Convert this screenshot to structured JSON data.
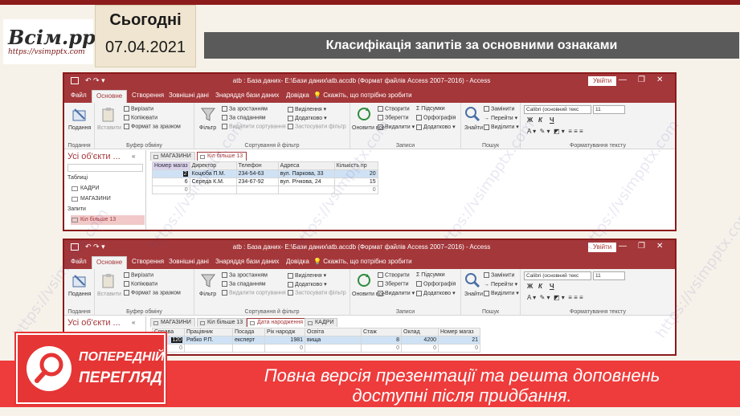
{
  "slide": {
    "logo": "Всім.pptx",
    "logo_url": "https://vsimpptx.com",
    "date_label": "Сьогодні",
    "date": "07.04.2021",
    "title": "Класифікація запитів за основними ознаками",
    "watermark": "https://vsimpptx.com"
  },
  "window1": {
    "title": "atb : База даних- E:\\Бази даних\\atb.accdb (Формат файлів Access 2007–2016)  -  Access",
    "signin": "Увійти",
    "tabs": [
      "Файл",
      "Основне",
      "Створення",
      "Зовнішні дані",
      "Знаряддя бази даних",
      "Довідка"
    ],
    "tellme": "Скажіть, що потрібно зробити",
    "ribbon": {
      "view": "Подання",
      "paste": "Вставити",
      "cut": "Вирізати",
      "copy": "Копіювати",
      "format_painter": "Формат за зразком",
      "filter": "Фільтр",
      "asc": "За зростанням",
      "desc": "За спаданням",
      "remove_sort": "Видалити сортування",
      "selection": "Виділення",
      "advanced": "Додатково",
      "toggle_filter": "Застосувати фільтр",
      "refresh": "Оновити все",
      "new": "Створити",
      "save": "Зберегти",
      "delete": "Видалити",
      "totals": "Підсумки",
      "spelling": "Орфографія",
      "more": "Додатково",
      "find": "Знайти",
      "replace": "Замінити",
      "goto": "Перейти",
      "select": "Виділити",
      "font": "Calibri (основний текс",
      "size": "11",
      "bold": "Ж",
      "italic": "К",
      "underline": "Ч",
      "groups": [
        "Подання",
        "Буфер обміну",
        "Сортування й фільтр",
        "Записи",
        "Пошук",
        "Форматування тексту"
      ]
    },
    "nav": {
      "header": "Усі об'єкти ...",
      "sections": [
        "Таблиці",
        "Запити"
      ],
      "tables": [
        "КАДРИ",
        "МАГАЗИНИ"
      ],
      "queries": [
        "Кіл більше 13"
      ]
    },
    "doc_tabs": [
      "МАГАЗИНИ",
      "Кіл більше 13"
    ],
    "grid": {
      "headers": [
        "Номер магаз",
        "Директор",
        "Телефон",
        "Адреса",
        "Кількість пр"
      ],
      "rows": [
        [
          "2",
          "Коцюба П.М.",
          "234-54-63",
          "вул. Паркова, 33",
          "20"
        ],
        [
          "6",
          "Середа К.М.",
          "234-67-92",
          "вул. Річкова, 24",
          "15"
        ],
        [
          "0",
          "",
          "",
          "",
          "0"
        ]
      ]
    }
  },
  "window2": {
    "title": "atb : База даних- E:\\Бази даних\\atb.accdb (Формат файлів Access 2007–2016)  -  Access",
    "signin": "Увійти",
    "tabs": [
      "Файл",
      "Основне",
      "Створення",
      "Зовнішні дані",
      "Знаряддя бази даних",
      "Довідка"
    ],
    "tellme": "Скажіть, що потрібно зробити",
    "nav_header": "Усі об'єкти ...",
    "doc_tabs": [
      "МАГАЗИНИ",
      "Кіл більше 13",
      "Дата народження",
      "КАДРИ"
    ],
    "grid": {
      "headers": [
        "Справа",
        "Працівник",
        "Посада",
        "Рік народж",
        "Освіта",
        "Стаж",
        "Оклад",
        "Номер магаз"
      ],
      "rows": [
        [
          "120",
          "Рябко Р.П.",
          "експерт",
          "1981",
          "вища",
          "8",
          "4200",
          "21"
        ],
        [
          "0",
          "",
          "",
          "0",
          "",
          "0",
          "0",
          "0"
        ]
      ]
    }
  },
  "banner": {
    "line1": "Повна версія презентації та решта доповнень",
    "line2": "доступні після придбання.",
    "preview_line1": "ПОПЕРЕДНІЙ",
    "preview_line2": "ПЕРЕГЛЯД"
  },
  "colors": {
    "access_red": "#a4373a",
    "banner_red": "#ee3b3b",
    "title_gray": "#5a5a5a"
  }
}
